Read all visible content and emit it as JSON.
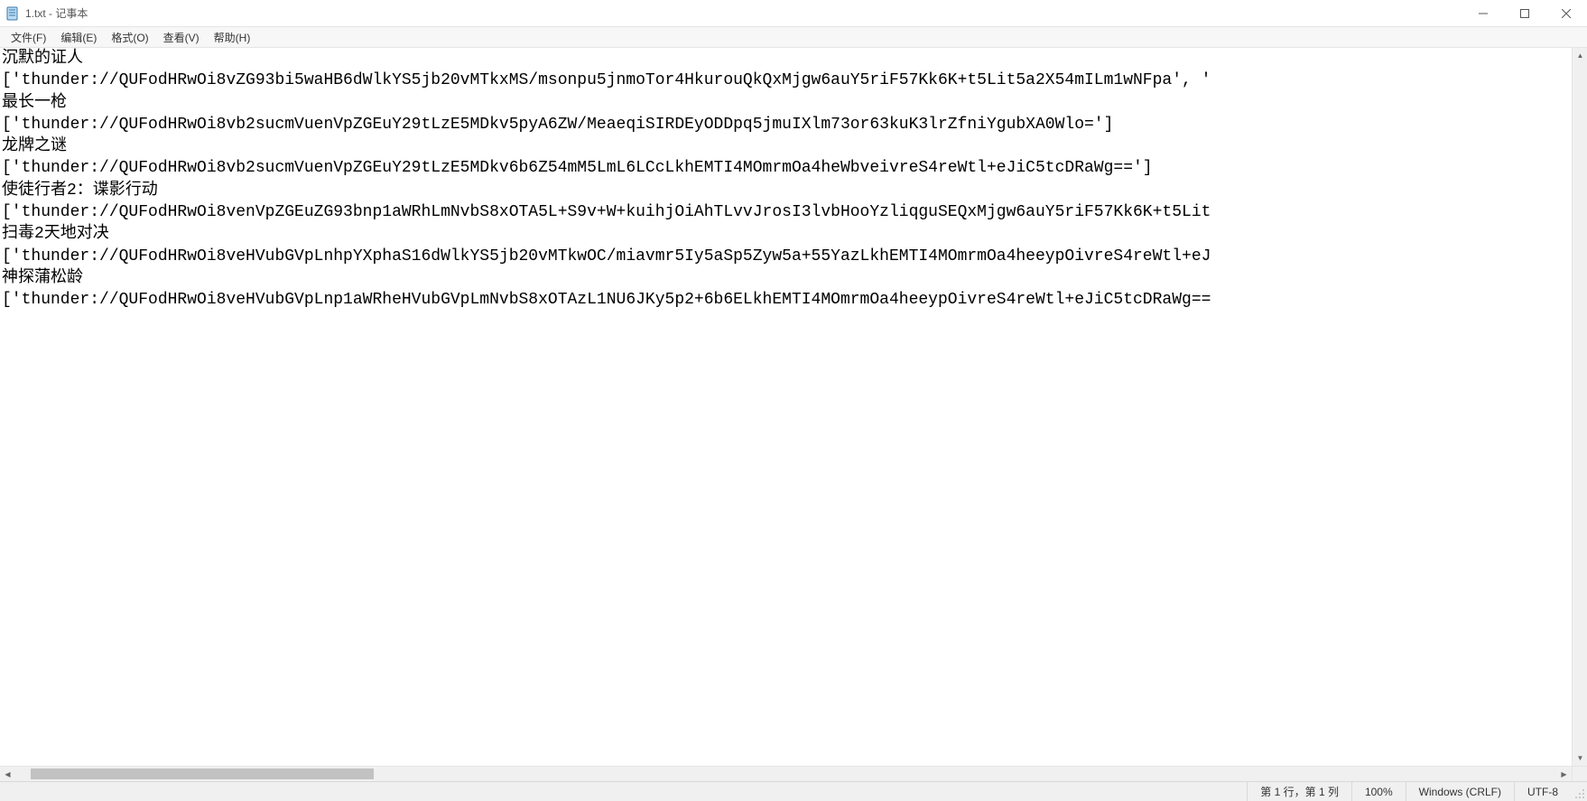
{
  "window": {
    "title": "1.txt - 记事本"
  },
  "menu": {
    "file": "文件(F)",
    "edit": "编辑(E)",
    "format": "格式(O)",
    "view": "查看(V)",
    "help": "帮助(H)"
  },
  "content": "沉默的证人\n['thunder://QUFodHRwOi8vZG93bi5waHB6dWlkYS5jb20vMTkxMS/msonpu5jnmoTor4HkurouQkQxMjgw6auY5riF57Kk6K+t5Lit5a2X54mILm1wNFpa', '\n最长一枪\n['thunder://QUFodHRwOi8vb2sucmVuenVpZGEuY29tLzE5MDkv5pyA6ZW/MeaeqiSIRDEyODDpq5jmuIXlm73or63kuK3lrZfniYgubXA0Wlo=']\n龙牌之谜\n['thunder://QUFodHRwOi8vb2sucmVuenVpZGEuY29tLzE5MDkv6b6Z54mM5LmL6LCcLkhEMTI4MOmrmOa4heWbveivreS4reWtl+eJiC5tcDRaWg==']\n使徒行者2：谍影行动\n['thunder://QUFodHRwOi8venVpZGEuZG93bnp1aWRhLmNvbS8xOTA5L+S9v+W+kuihjOiAhTLvvJrosI3lvbHooYzliqguSEQxMjgw6auY5riF57Kk6K+t5Lit\n扫毒2天地对决\n['thunder://QUFodHRwOi8veHVubGVpLnhpYXphaS16dWlkYS5jb20vMTkwOC/miavmr5Iy5aSp5Zyw5a+55YazLkhEMTI4MOmrmOa4heeypOivreS4reWtl+eJ\n神探蒲松龄\n['thunder://QUFodHRwOi8veHVubGVpLnp1aWRheHVubGVpLmNvbS8xOTAzL1NU6JKy5p2+6b6ELkhEMTI4MOmrmOa4heeypOivreS4reWtl+eJiC5tcDRaWg==",
  "status": {
    "position": "第 1 行，第 1 列",
    "zoom": "100%",
    "line_ending": "Windows (CRLF)",
    "encoding": "UTF-8"
  }
}
